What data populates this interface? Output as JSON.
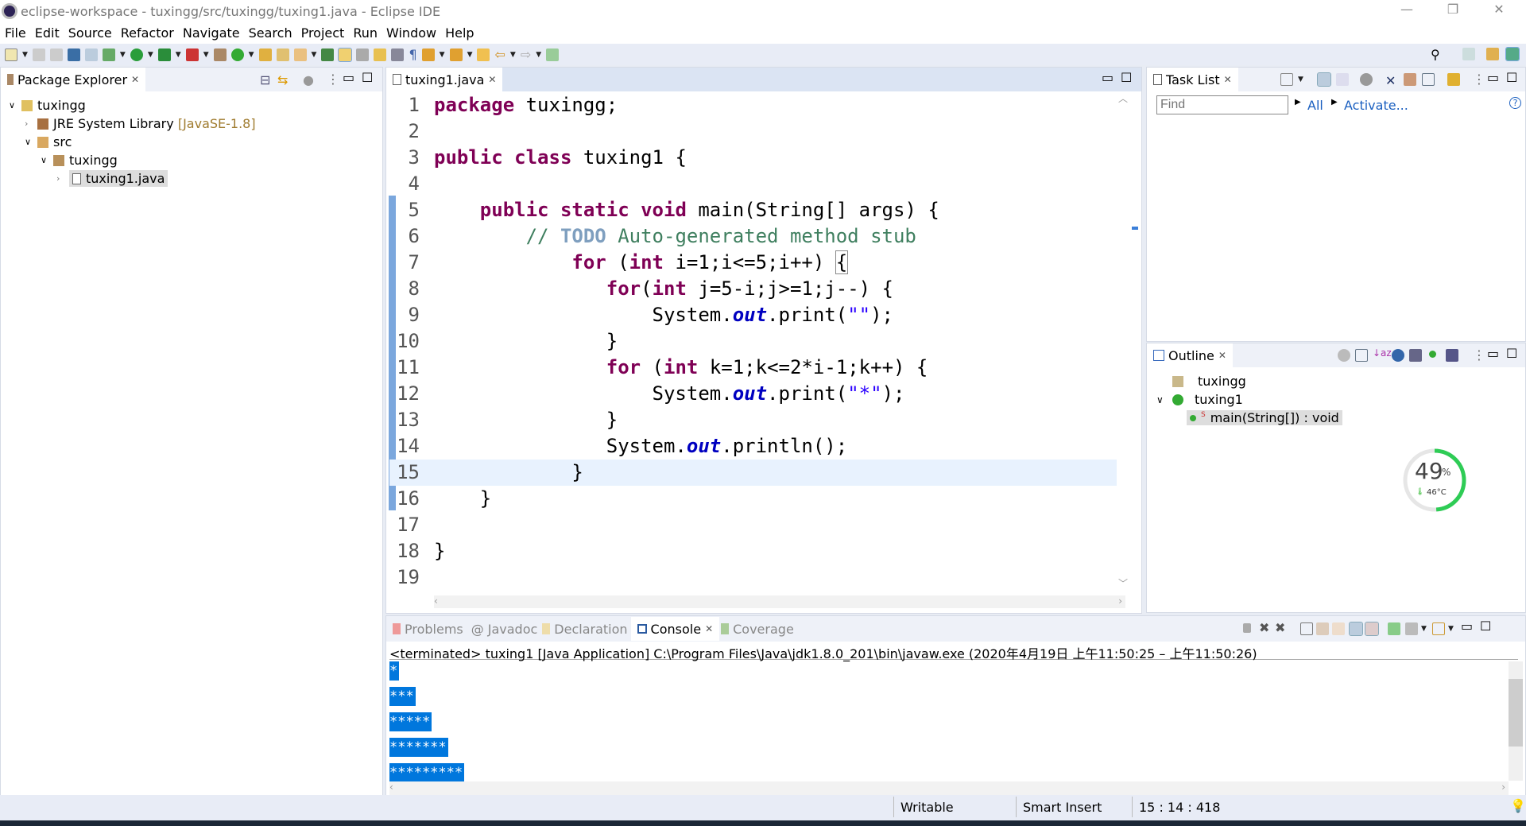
{
  "window": {
    "title": "eclipse-workspace - tuxingg/src/tuxingg/tuxing1.java - Eclipse IDE",
    "minimize": "—",
    "restore": "❐",
    "close": "✕"
  },
  "menu": [
    "File",
    "Edit",
    "Source",
    "Refactor",
    "Navigate",
    "Search",
    "Project",
    "Run",
    "Window",
    "Help"
  ],
  "package_explorer": {
    "title": "Package Explorer",
    "items": [
      {
        "label": "tuxingg",
        "suffix": ""
      },
      {
        "label": "JRE System Library",
        "suffix": "[JavaSE-1.8]"
      },
      {
        "label": "src",
        "suffix": ""
      },
      {
        "label": "tuxingg",
        "suffix": ""
      },
      {
        "label": "tuxing1.java",
        "suffix": ""
      }
    ]
  },
  "editor": {
    "tab": "tuxing1.java",
    "current_line": 15,
    "lines": [
      [
        [
          "kw",
          "package"
        ],
        [
          "pl",
          " tuxingg;"
        ]
      ],
      [],
      [
        [
          "kw",
          "public"
        ],
        [
          "pl",
          " "
        ],
        [
          "kw",
          "class"
        ],
        [
          "pl",
          " tuxing1 {"
        ]
      ],
      [],
      [
        [
          "pl",
          "    "
        ],
        [
          "kw",
          "public"
        ],
        [
          "pl",
          " "
        ],
        [
          "kw",
          "static"
        ],
        [
          "pl",
          " "
        ],
        [
          "kw",
          "void"
        ],
        [
          "pl",
          " main(String[] args) {"
        ]
      ],
      [
        [
          "pl",
          "        "
        ],
        [
          "cm",
          "// "
        ],
        [
          "todo",
          "TODO"
        ],
        [
          "cm",
          " Auto-generated method stub"
        ]
      ],
      [
        [
          "pl",
          "            "
        ],
        [
          "kw",
          "for"
        ],
        [
          "pl",
          " ("
        ],
        [
          "kw",
          "int"
        ],
        [
          "pl",
          " i=1;i<=5;i++) {"
        ]
      ],
      [
        [
          "pl",
          "               "
        ],
        [
          "kw",
          "for"
        ],
        [
          "pl",
          "("
        ],
        [
          "kw",
          "int"
        ],
        [
          "pl",
          " j=5-i;j>=1;j--) {"
        ]
      ],
      [
        [
          "pl",
          "                   System."
        ],
        [
          "fld",
          "out"
        ],
        [
          "pl",
          ".print("
        ],
        [
          "str",
          "\"\""
        ],
        [
          "pl",
          ");"
        ]
      ],
      [
        [
          "pl",
          "               }"
        ]
      ],
      [
        [
          "pl",
          "               "
        ],
        [
          "kw",
          "for"
        ],
        [
          "pl",
          " ("
        ],
        [
          "kw",
          "int"
        ],
        [
          "pl",
          " k=1;k<=2*i-1;k++) {"
        ]
      ],
      [
        [
          "pl",
          "                   System."
        ],
        [
          "fld",
          "out"
        ],
        [
          "pl",
          ".print("
        ],
        [
          "str",
          "\"*\""
        ],
        [
          "pl",
          ");"
        ]
      ],
      [
        [
          "pl",
          "               }"
        ]
      ],
      [
        [
          "pl",
          "               System."
        ],
        [
          "fld",
          "out"
        ],
        [
          "pl",
          ".println();"
        ]
      ],
      [
        [
          "pl",
          "            }"
        ]
      ],
      [
        [
          "pl",
          "    }"
        ]
      ],
      [],
      [
        [
          "pl",
          "}"
        ]
      ],
      []
    ]
  },
  "task_list": {
    "title": "Task List",
    "find_placeholder": "Find",
    "all": "All",
    "activate": "Activate..."
  },
  "outline": {
    "title": "Outline",
    "items": [
      "tuxingg",
      "tuxing1",
      "main(String[]) : void"
    ]
  },
  "widget": {
    "percent": 49,
    "percent_label": "49",
    "percent_sign": "%",
    "temp": "46°C"
  },
  "console": {
    "tabs": [
      "Problems",
      "Javadoc",
      "Declaration",
      "Console",
      "Coverage"
    ],
    "active_tab": "Console",
    "header": "<terminated> tuxing1 [Java Application] C:\\Program Files\\Java\\jdk1.8.0_201\\bin\\javaw.exe  (2020年4月19日 上午11:50:25 – 上午11:50:26)",
    "output": [
      "*",
      "***",
      "*****",
      "*******",
      "*********"
    ]
  },
  "status": {
    "mode": "Writable",
    "insert": "Smart Insert",
    "position": "15 : 14 : 418"
  },
  "colors": {
    "keyword": "#7f0055",
    "comment": "#3f7f5f",
    "string": "#2a00ff",
    "selection": "#0077dd",
    "current_line": "#e8f2fe"
  }
}
